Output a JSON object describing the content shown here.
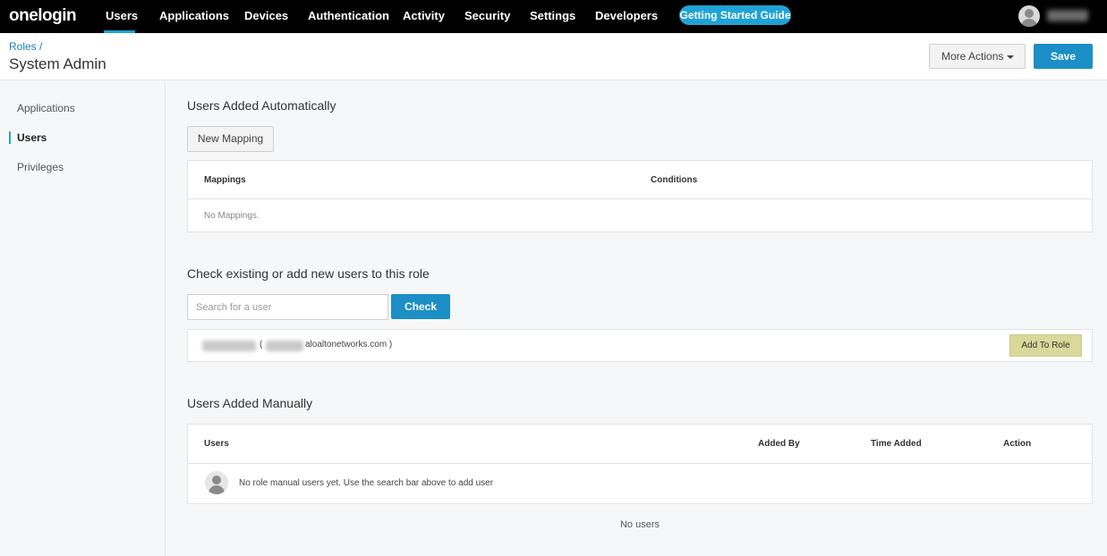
{
  "nav": {
    "logo": "onelogin",
    "items": [
      "Users",
      "Applications",
      "Devices",
      "Authentication",
      "Activity",
      "Security",
      "Settings",
      "Developers"
    ],
    "guide_label": "Getting Started Guide"
  },
  "header": {
    "breadcrumb": "Roles /",
    "title": "System Admin",
    "more_actions": "More Actions",
    "save": "Save"
  },
  "sidebar": {
    "items": [
      "Applications",
      "Users",
      "Privileges"
    ]
  },
  "auto": {
    "title": "Users Added Automatically",
    "new_mapping": "New Mapping",
    "col_mappings": "Mappings",
    "col_conditions": "Conditions",
    "empty": "No Mappings."
  },
  "check": {
    "title": "Check existing or add new users to this role",
    "placeholder": "Search for a user",
    "button": "Check",
    "result_open": "(",
    "result_email_visible": "aloaltonetworks.com )",
    "add_to_role": "Add To Role"
  },
  "manual": {
    "title": "Users Added Manually",
    "col_users": "Users",
    "col_added_by": "Added By",
    "col_time_added": "Time Added",
    "col_action": "Action",
    "empty_row": "No role manual users yet. Use the search bar above to add user",
    "no_users": "No users"
  },
  "colors": {
    "accent": "#1fa3d4",
    "primary_button": "#1b8fc6",
    "add_role_button": "#d8d99a"
  }
}
